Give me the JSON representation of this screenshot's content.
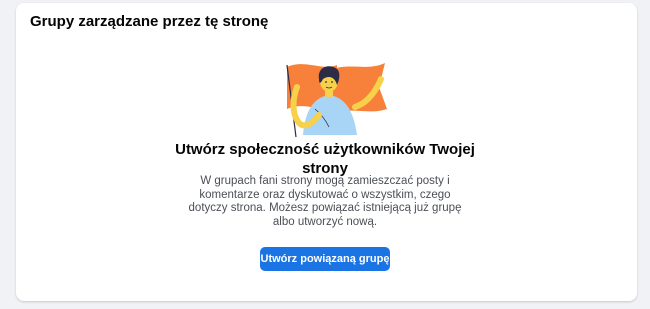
{
  "panel": {
    "title": "Grupy zarządzane przez tę stronę"
  },
  "empty_state": {
    "illustration": "person-holding-flag-illustration",
    "title": "Utwórz społeczność użytkowników Twojej strony",
    "description": "W grupach fani strony mogą zamieszczać posty i komentarze oraz dyskutować o wszystkim, czego dotyczy strona. Możesz powiązać istniejącą już grupę albo utworzyć nową.",
    "button_label": "Utwórz powiązaną grupę"
  },
  "colors": {
    "button_background": "#1b74e4",
    "page_background": "#f0f2f5",
    "flag_orange": "#f7813a",
    "hair_dark": "#2d2c46",
    "shirt_blue": "#a8d5f5",
    "skin_yellow": "#f8d14b"
  }
}
